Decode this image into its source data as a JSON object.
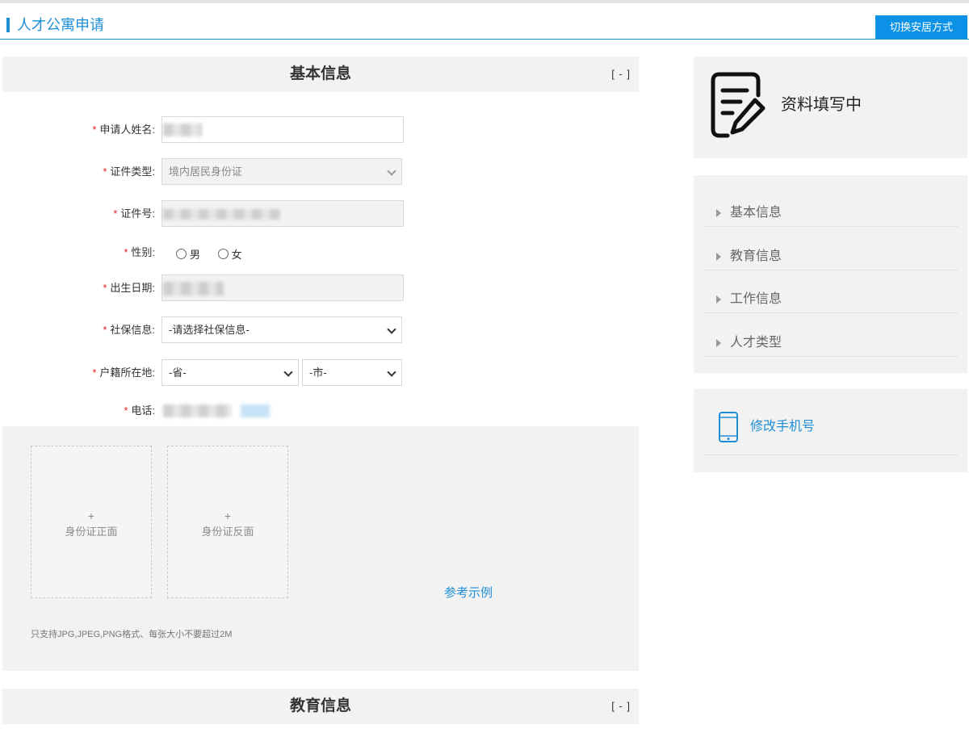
{
  "header": {
    "title": "人才公寓申请",
    "switch_button": "切换安居方式"
  },
  "basic_section": {
    "title": "基本信息",
    "toggle": "[ - ]"
  },
  "form": {
    "required_mark": "*",
    "name_label": "申请人姓名:",
    "id_type_label": "证件类型:",
    "id_type_value": "境内居民身份证",
    "id_number_label": "证件号:",
    "gender_label": "性别:",
    "gender_options": [
      "男",
      "女"
    ],
    "birth_label": "出生日期:",
    "social_label": "社保信息:",
    "social_value": "-请选择社保信息-",
    "hukou_label": "户籍所在地:",
    "province_value": "-省-",
    "city_value": "-市-",
    "phone_label": "电话:"
  },
  "upload": {
    "plus": "+",
    "front_label": "身份证正面",
    "back_label": "身份证反面",
    "example_link": "参考示例",
    "note": "只支持JPG,JPEG,PNG格式、每张大小不要超过2M"
  },
  "education_section": {
    "title": "教育信息",
    "toggle": "[ - ]"
  },
  "sidebar": {
    "status_text": "资料填写中",
    "nav_items": [
      {
        "label": "基本信息"
      },
      {
        "label": "教育信息"
      },
      {
        "label": "工作信息"
      },
      {
        "label": "人才类型"
      }
    ],
    "change_phone": "修改手机号"
  },
  "colors": {
    "accent": "#1e8fd6",
    "required": "#e02020",
    "panel": "#f2f2f2"
  }
}
